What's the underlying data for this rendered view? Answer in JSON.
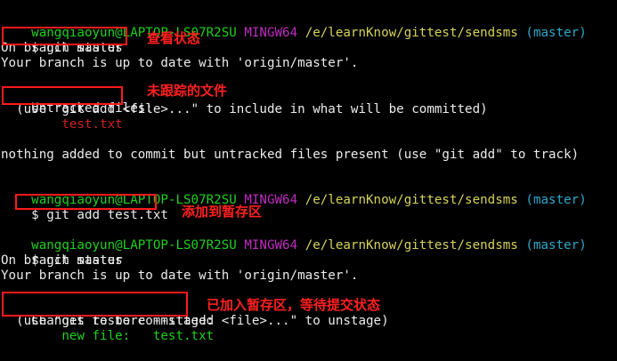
{
  "colors": {
    "background": "#000000",
    "text": "#ececec",
    "user_host": "#1fd01f",
    "shell": "#c12cc1",
    "path": "#d6d25a",
    "branch": "#2ca8c9",
    "untracked_file": "#d02020",
    "staged_file": "#1fd01f",
    "annotation": "#ff1a1a"
  },
  "prompt": {
    "user_host": "wangqiaoyun@LAPTOP-LS07R2SU",
    "shell": "MINGW64",
    "path": "/e/learnKnow/gittest/sendsms",
    "branch": "(master)",
    "symbol": "$"
  },
  "block1": {
    "command": "git status",
    "on_branch": "On branch master",
    "up_to_date": "Your branch is up to date with 'origin/master'.",
    "section_header": "Untracked files",
    "section_colon": ":",
    "hint": "  (use \"git add <file>...\" to include in what will be committed)",
    "file": "        test.txt",
    "summary": "nothing added to commit but untracked files present (use \"git add\" to track)"
  },
  "block2": {
    "command": "git add test.txt"
  },
  "block3": {
    "command": "git status",
    "on_branch": "On branch master",
    "up_to_date": "Your branch is up to date with 'origin/master'.",
    "section_header": "Changes to be committed",
    "section_colon": ":",
    "hint": "  (use \"git restore --staged <file>...\" to unstage)",
    "file": "        new file:   test.txt"
  },
  "annotations": {
    "check_status": "查看状态",
    "untracked": "未跟踪的文件",
    "add_to_stage": "添加到暂存区",
    "staged": "已加入暂存区，等待提交状态"
  }
}
